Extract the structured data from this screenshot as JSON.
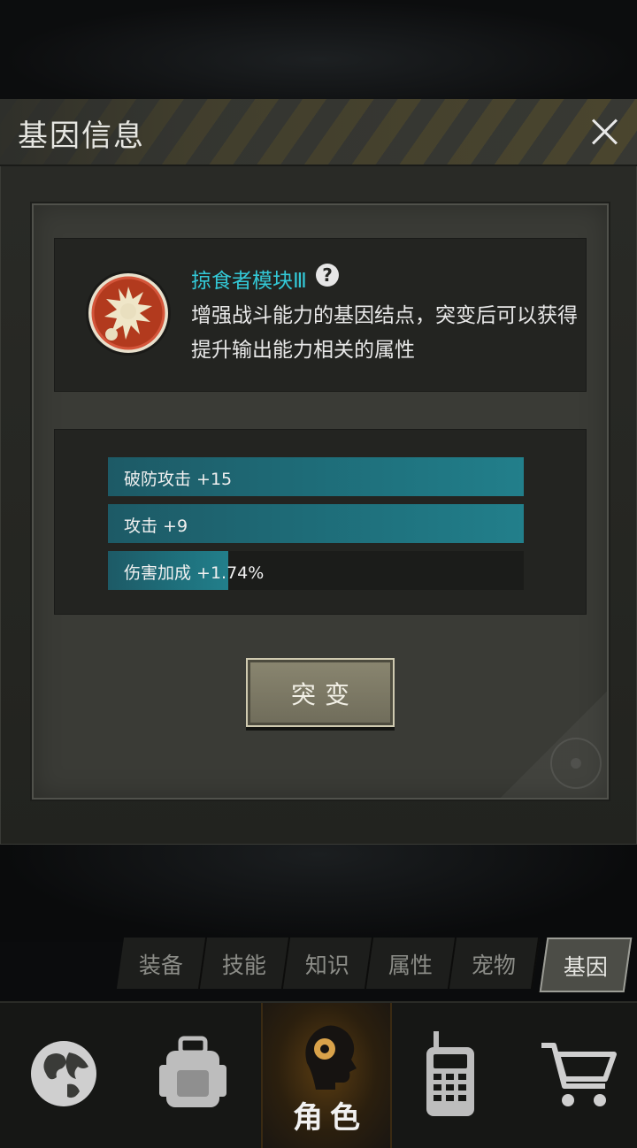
{
  "dialog": {
    "title": "基因信息",
    "close_icon": "close-icon",
    "gene": {
      "icon": "predator-module-emblem-icon",
      "name": "掠食者模块Ⅲ",
      "help_icon": "?",
      "description": "增强战斗能力的基因结点，突变后可以获得提升输出能力相关的属性"
    },
    "stats": [
      {
        "label": "破防攻击 +15",
        "fill_fraction": 1.0
      },
      {
        "label": "攻击 +9",
        "fill_fraction": 1.0
      },
      {
        "label": "伤害加成 +1.74%",
        "fill_fraction": 0.29
      }
    ],
    "mutate_button": "突变"
  },
  "sub_tabs": [
    {
      "label": "装备",
      "active": false
    },
    {
      "label": "技能",
      "active": false
    },
    {
      "label": "知识",
      "active": false
    },
    {
      "label": "属性",
      "active": false
    },
    {
      "label": "宠物",
      "active": false
    },
    {
      "label": "基因",
      "active": true
    }
  ],
  "bottom_nav": [
    {
      "icon": "globe-icon",
      "label": ""
    },
    {
      "icon": "backpack-icon",
      "label": ""
    },
    {
      "icon": "character-head-icon",
      "label": "角色",
      "active": true
    },
    {
      "icon": "walkie-talkie-icon",
      "label": ""
    },
    {
      "icon": "shopping-cart-icon",
      "label": ""
    }
  ],
  "colors": {
    "accent_cyan": "#33c8d6",
    "stat_fill": "#1f7480",
    "nav_active": "#5b3d12"
  }
}
